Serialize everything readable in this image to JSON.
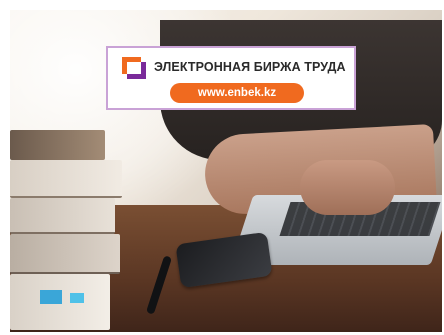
{
  "banner": {
    "title": "ЭЛЕКТРОННАЯ БИРЖА ТРУДА",
    "url": "www.enbek.kz"
  },
  "icons": {
    "logo": "enbek-logo-icon"
  },
  "colors": {
    "accent": "#f06a1f",
    "logo_orange": "#f06a1f",
    "logo_purple": "#7a2a9a",
    "border": "#c9a2d6"
  }
}
